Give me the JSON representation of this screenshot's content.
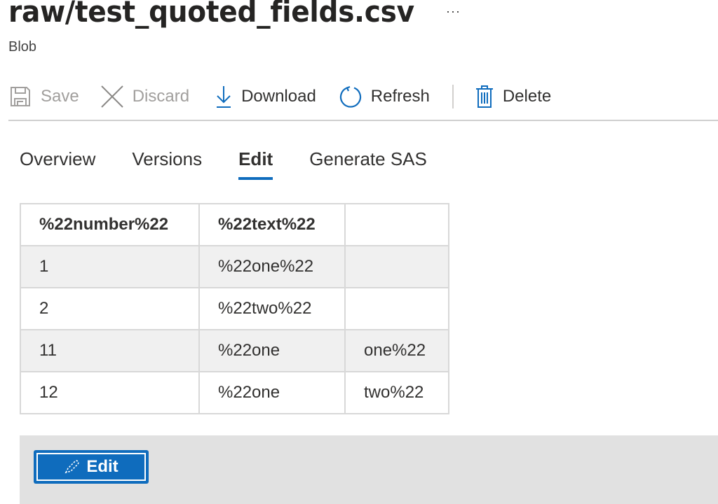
{
  "header": {
    "title": "raw/test_quoted_fields.csv",
    "more_label": "···",
    "subtitle": "Blob"
  },
  "toolbar": {
    "items": [
      {
        "label": "Save",
        "icon": "save-icon",
        "enabled": false
      },
      {
        "label": "Discard",
        "icon": "close-icon",
        "enabled": false
      },
      {
        "label": "Download",
        "icon": "download-icon",
        "enabled": true
      },
      {
        "label": "Refresh",
        "icon": "refresh-icon",
        "enabled": true
      },
      {
        "label": "Delete",
        "icon": "trash-icon",
        "enabled": true
      }
    ]
  },
  "tabs": [
    {
      "label": "Overview",
      "active": false
    },
    {
      "label": "Versions",
      "active": false
    },
    {
      "label": "Edit",
      "active": true
    },
    {
      "label": "Generate SAS",
      "active": false
    }
  ],
  "table": {
    "headers": [
      "%22number%22",
      "%22text%22",
      ""
    ],
    "rows": [
      [
        "1",
        "%22one%22",
        ""
      ],
      [
        "2",
        "%22two%22",
        ""
      ],
      [
        "11",
        "%22one",
        "one%22"
      ],
      [
        "12",
        "%22one",
        "two%22"
      ]
    ]
  },
  "panel": {
    "edit_button_label": "Edit",
    "edit_button_icon": "edit-pencil-icon"
  },
  "colors": {
    "accent": "#0f6cbd",
    "disabled_text": "#a19f9d",
    "panel_background": "#e1e1e1",
    "alt_row": "#f0f0f0"
  }
}
